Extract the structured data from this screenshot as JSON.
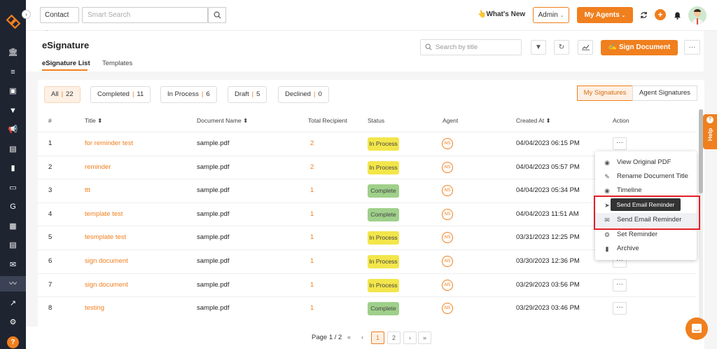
{
  "topbar": {
    "contact_select": "Contact",
    "search_placeholder": "Smart Search",
    "whats_new": "What's New",
    "admin_select": "Admin",
    "my_agents": "My Agents"
  },
  "sidebar": {
    "items": [
      "bank-icon",
      "list-icon",
      "contact-card-icon",
      "funnel-icon",
      "megaphone-icon",
      "document-icon",
      "bar-chart-icon",
      "folder-icon",
      "google-icon",
      "sheet-icon",
      "calendar-icon",
      "mail-icon",
      "signature-icon",
      "trend-icon",
      "gear-icon"
    ],
    "help": "?"
  },
  "header": {
    "title": "eSignature",
    "tabs": [
      "eSignature List",
      "Templates"
    ],
    "search_placeholder": "Search by title",
    "sign_document": "Sign Document"
  },
  "filters": [
    {
      "label": "All",
      "count": "22"
    },
    {
      "label": "Completed",
      "count": "11"
    },
    {
      "label": "In Process",
      "count": "6"
    },
    {
      "label": "Draft",
      "count": "5"
    },
    {
      "label": "Declined",
      "count": "0"
    }
  ],
  "segments": [
    "My Signatures",
    "Agent Signatures"
  ],
  "table": {
    "columns": [
      "#",
      "Title",
      "Document Name",
      "Total Recipient",
      "Status",
      "Agent",
      "Created At",
      "Action"
    ],
    "rows": [
      {
        "num": "1",
        "title": "for reminder test",
        "doc": "sample.pdf",
        "recipients": "2",
        "status": "In Process",
        "agent": "NS",
        "created": "04/04/2023 06:15 PM"
      },
      {
        "num": "2",
        "title": "reminder",
        "doc": "sample.pdf",
        "recipients": "2",
        "status": "In Process",
        "agent": "NS",
        "created": "04/04/2023 05:57 PM"
      },
      {
        "num": "3",
        "title": "ttt",
        "doc": "sample.pdf",
        "recipients": "1",
        "status": "Complete",
        "agent": "NS",
        "created": "04/04/2023 05:34 PM"
      },
      {
        "num": "4",
        "title": "template test",
        "doc": "sample.pdf",
        "recipients": "1",
        "status": "Complete",
        "agent": "NS",
        "created": "04/04/2023 11:51 AM"
      },
      {
        "num": "5",
        "title": "tesmplate test",
        "doc": "sample.pdf",
        "recipients": "1",
        "status": "In Process",
        "agent": "NS",
        "created": "03/31/2023 12:25 PM"
      },
      {
        "num": "6",
        "title": "sign document",
        "doc": "sample.pdf",
        "recipients": "1",
        "status": "In Process",
        "agent": "NS",
        "created": "03/30/2023 12:36 PM"
      },
      {
        "num": "7",
        "title": "sign document",
        "doc": "sample.pdf",
        "recipients": "1",
        "status": "In Process",
        "agent": "NS",
        "created": "03/29/2023 03:56 PM"
      },
      {
        "num": "8",
        "title": "testing",
        "doc": "sample.pdf",
        "recipients": "1",
        "status": "Complete",
        "agent": "NS",
        "created": "03/29/2023 03:46 PM"
      }
    ]
  },
  "action_menu": {
    "items": [
      "View Original PDF",
      "Rename Document Title",
      "Timeline",
      "",
      "Send Email Reminder",
      "Set Reminder",
      "Archive"
    ],
    "tooltip": "Send Email Reminder"
  },
  "help_tab": "Help",
  "pagination": {
    "label": "Page 1 / 2",
    "first": "«",
    "prev": "‹",
    "pages": [
      "1",
      "2"
    ],
    "next": "›",
    "last": "»"
  },
  "colors": {
    "accent": "#f07f1e",
    "sidebar": "#1f2431",
    "in_process": "#f3e64b",
    "complete": "#9fd08a",
    "highlight": "#e0202a"
  }
}
